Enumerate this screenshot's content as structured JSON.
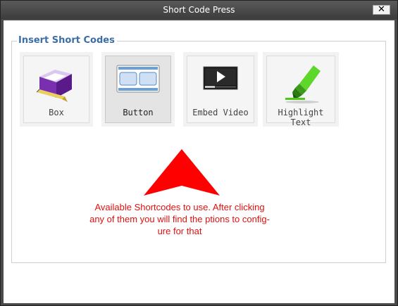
{
  "window": {
    "title": "Short Code Press",
    "close_label": "✕"
  },
  "section": {
    "legend": "Insert Short Codes"
  },
  "tiles": [
    {
      "label": "Box",
      "icon": "box-icon"
    },
    {
      "label": "Button",
      "icon": "button-icon",
      "selected": true
    },
    {
      "label": "Embed Video",
      "icon": "video-icon"
    },
    {
      "label": "Highlight Text",
      "icon": "highlighter-icon"
    }
  ],
  "annotation": {
    "line1": "Available Shortcodes to use. After clicking",
    "line2": "any of them you will find the ptions to confi­g-",
    "line3": "ure for that"
  },
  "colors": {
    "legend": "#3a6ea5",
    "annotation": "#e01010",
    "arrow": "#ff0000"
  }
}
